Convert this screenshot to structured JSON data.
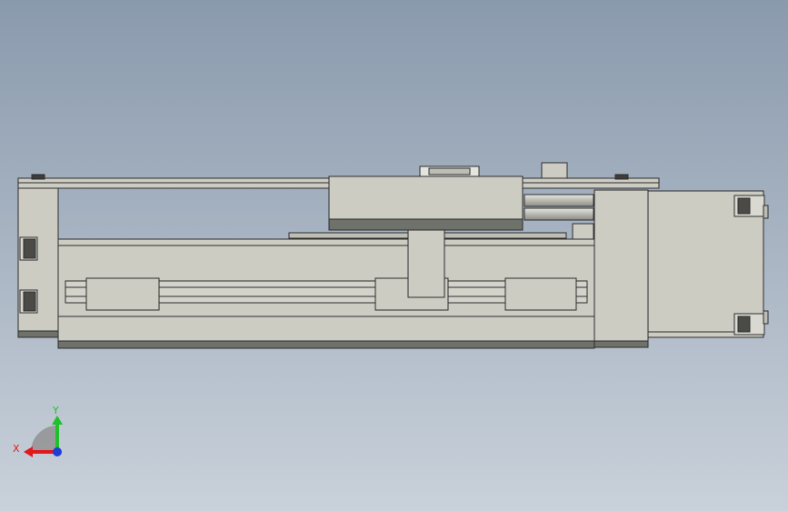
{
  "viewport": {
    "background_top": "#8a9aad",
    "background_bottom": "#c9d1da"
  },
  "model": {
    "part_fill": "#cdccc2",
    "part_shadow": "#6f716b",
    "outline": "#2d2d2d"
  },
  "triad": {
    "x_label": "X",
    "y_label": "Y",
    "x_color": "#e0191d",
    "y_color": "#20c02a",
    "z_color": "#1d3fd6"
  }
}
